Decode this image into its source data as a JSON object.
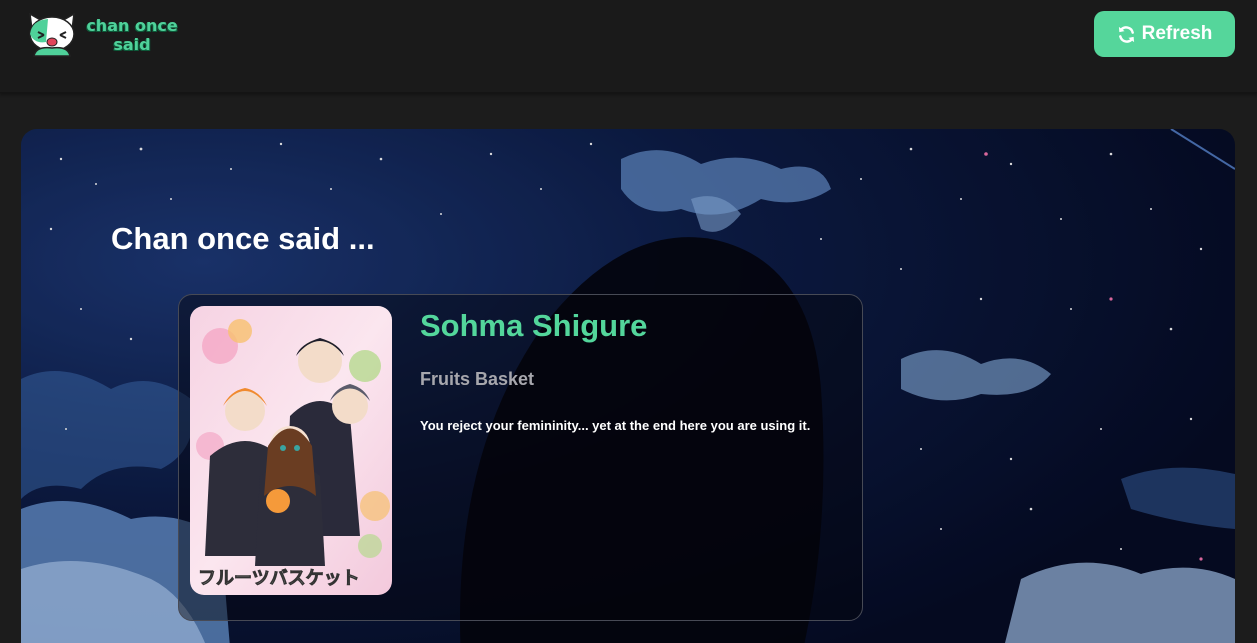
{
  "header": {
    "logo_text": "chan once said",
    "logo_icon": "cat-mascot-icon",
    "refresh_label": "Refresh",
    "refresh_icon": "refresh-icon"
  },
  "hero": {
    "heading": "Chan once said ..."
  },
  "quote": {
    "character": "Sohma Shigure",
    "anime": "Fruits Basket",
    "text": "You reject your femininity... yet at the end here you are using it.",
    "cover_caption": "フルーツバスケット"
  },
  "colors": {
    "accent": "#55d69b",
    "navbar": "#1a1a1a",
    "page_bg": "#1c1c1c",
    "card_border": "#474a55"
  }
}
